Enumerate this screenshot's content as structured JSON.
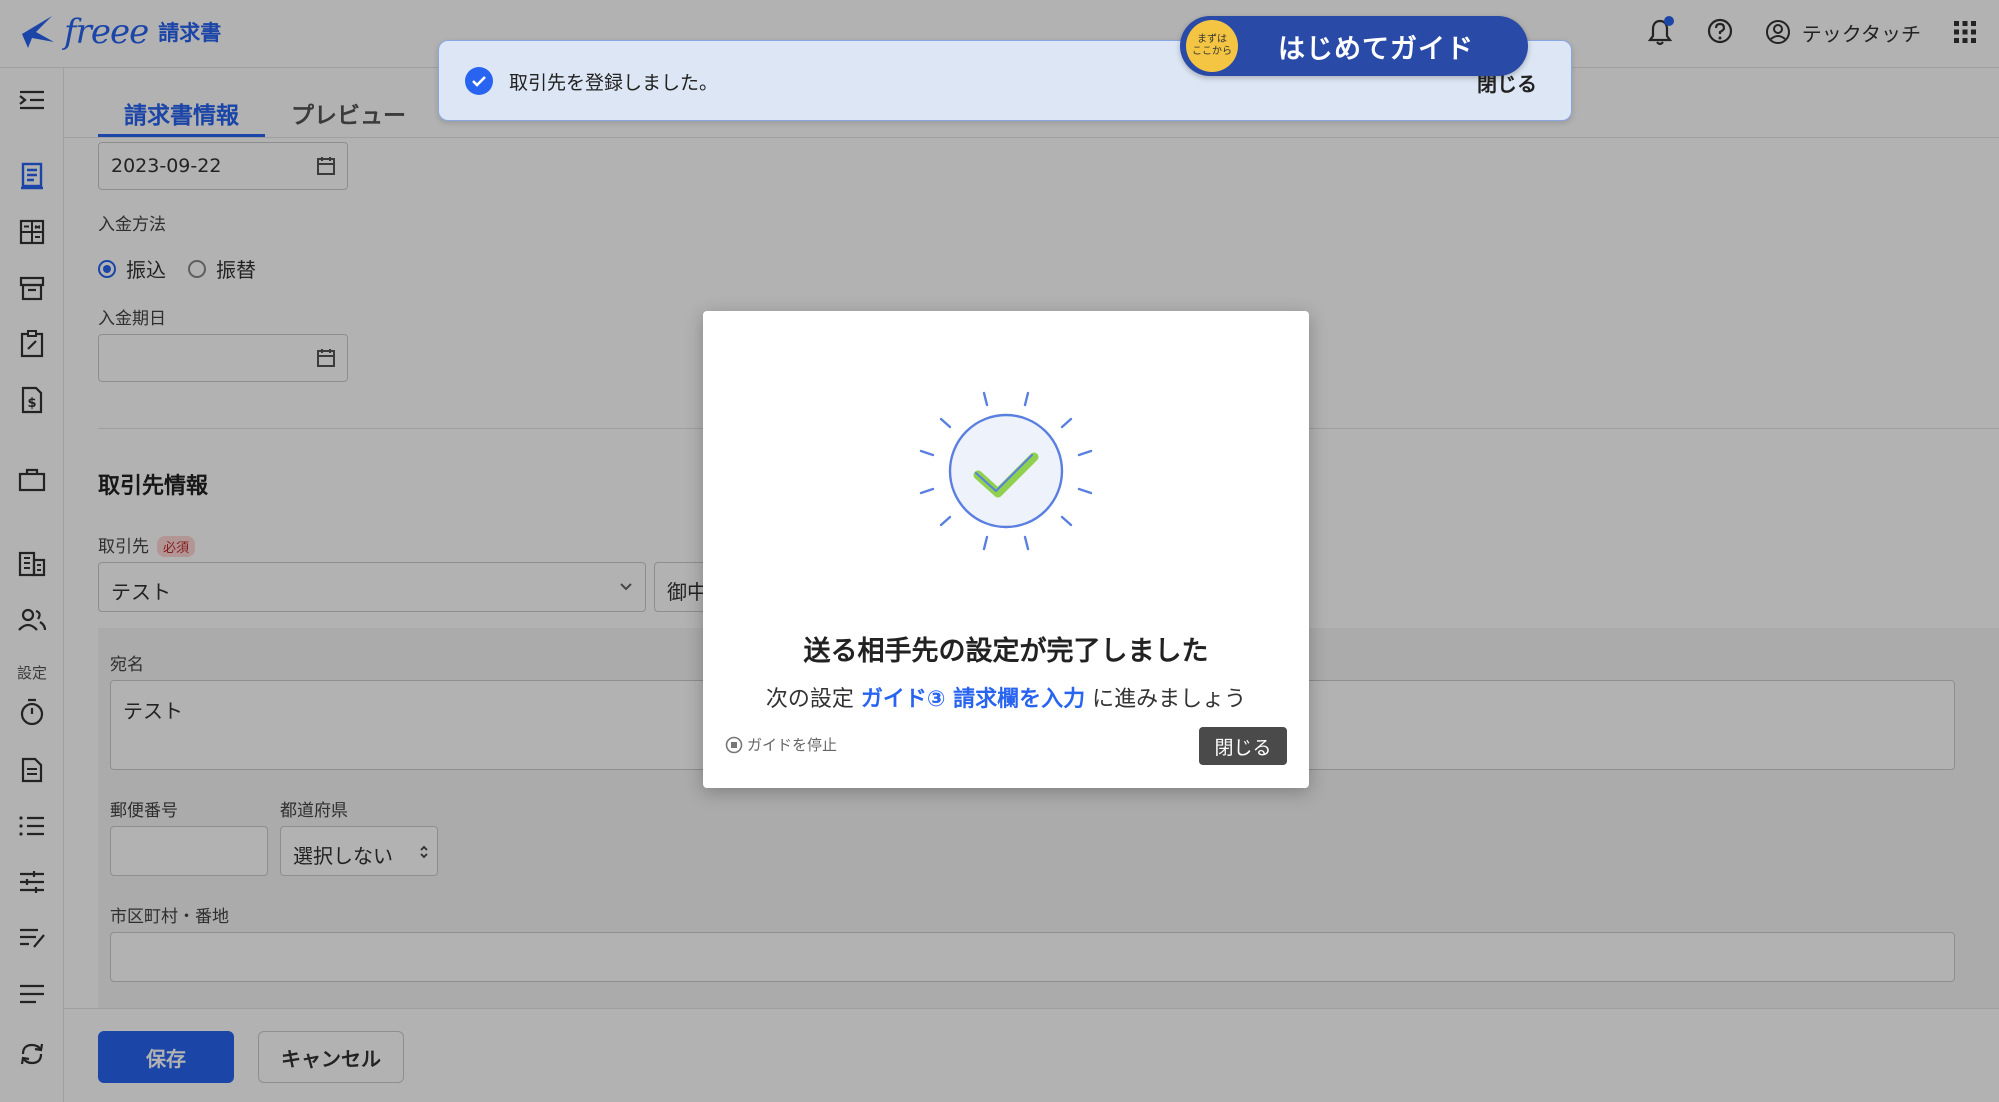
{
  "header": {
    "logo_word": "freee",
    "logo_product": "請求書",
    "user_name": "テックタッチ",
    "icons": [
      "bell-icon",
      "help-icon",
      "account-icon",
      "apps-grid-icon"
    ]
  },
  "sidebar": {
    "settings_label": "設定",
    "icons": [
      "collapse-menu-icon",
      "invoice-icon",
      "quote-icon",
      "archive-icon",
      "order-icon",
      "receipt-icon",
      "briefcase-icon",
      "building-icon",
      "people-icon",
      "timer-icon",
      "document-icon",
      "list-icon",
      "sliders-icon",
      "edit-list-icon",
      "lines-icon",
      "sync-icon"
    ]
  },
  "tabs": [
    {
      "label": "請求書情報",
      "active": true
    },
    {
      "label": "プレビュー",
      "active": false
    }
  ],
  "form": {
    "date_value": "2023-09-22",
    "payment_method_label": "入金方法",
    "payment_options": [
      "振込",
      "振替"
    ],
    "payment_selected": "振込",
    "due_date_label": "入金期日",
    "due_date_value": "",
    "partner_section_title": "取引先情報",
    "partner_label": "取引先",
    "required_badge": "必須",
    "partner_value": "テスト",
    "honorific_value": "御中",
    "addressee_label": "宛名",
    "addressee_value": "テスト",
    "postal_label": "郵便番号",
    "postal_value": "",
    "prefecture_label": "都道府県",
    "prefecture_value": "選択しない",
    "address_label": "市区町村・番地",
    "address_value": ""
  },
  "footer": {
    "save_label": "保存",
    "cancel_label": "キャンセル"
  },
  "toast": {
    "message": "取引先を登録しました。",
    "close_label": "閉じる"
  },
  "guide": {
    "badge_line1": "まずは",
    "badge_line2": "ここから",
    "label": "はじめてガイド"
  },
  "modal": {
    "title": "送る相手先の設定が完了しました",
    "sub_prefix": "次の設定",
    "sub_link": "ガイド③ 請求欄を入力",
    "sub_suffix": "に進みましょう",
    "stop_label": "ガイドを停止",
    "close_label": "閉じる"
  },
  "colors": {
    "brand": "#2864f0",
    "guide_pill": "#2a4aa8",
    "badge_yellow": "#f4c542",
    "check_green": "#8fd14f"
  }
}
